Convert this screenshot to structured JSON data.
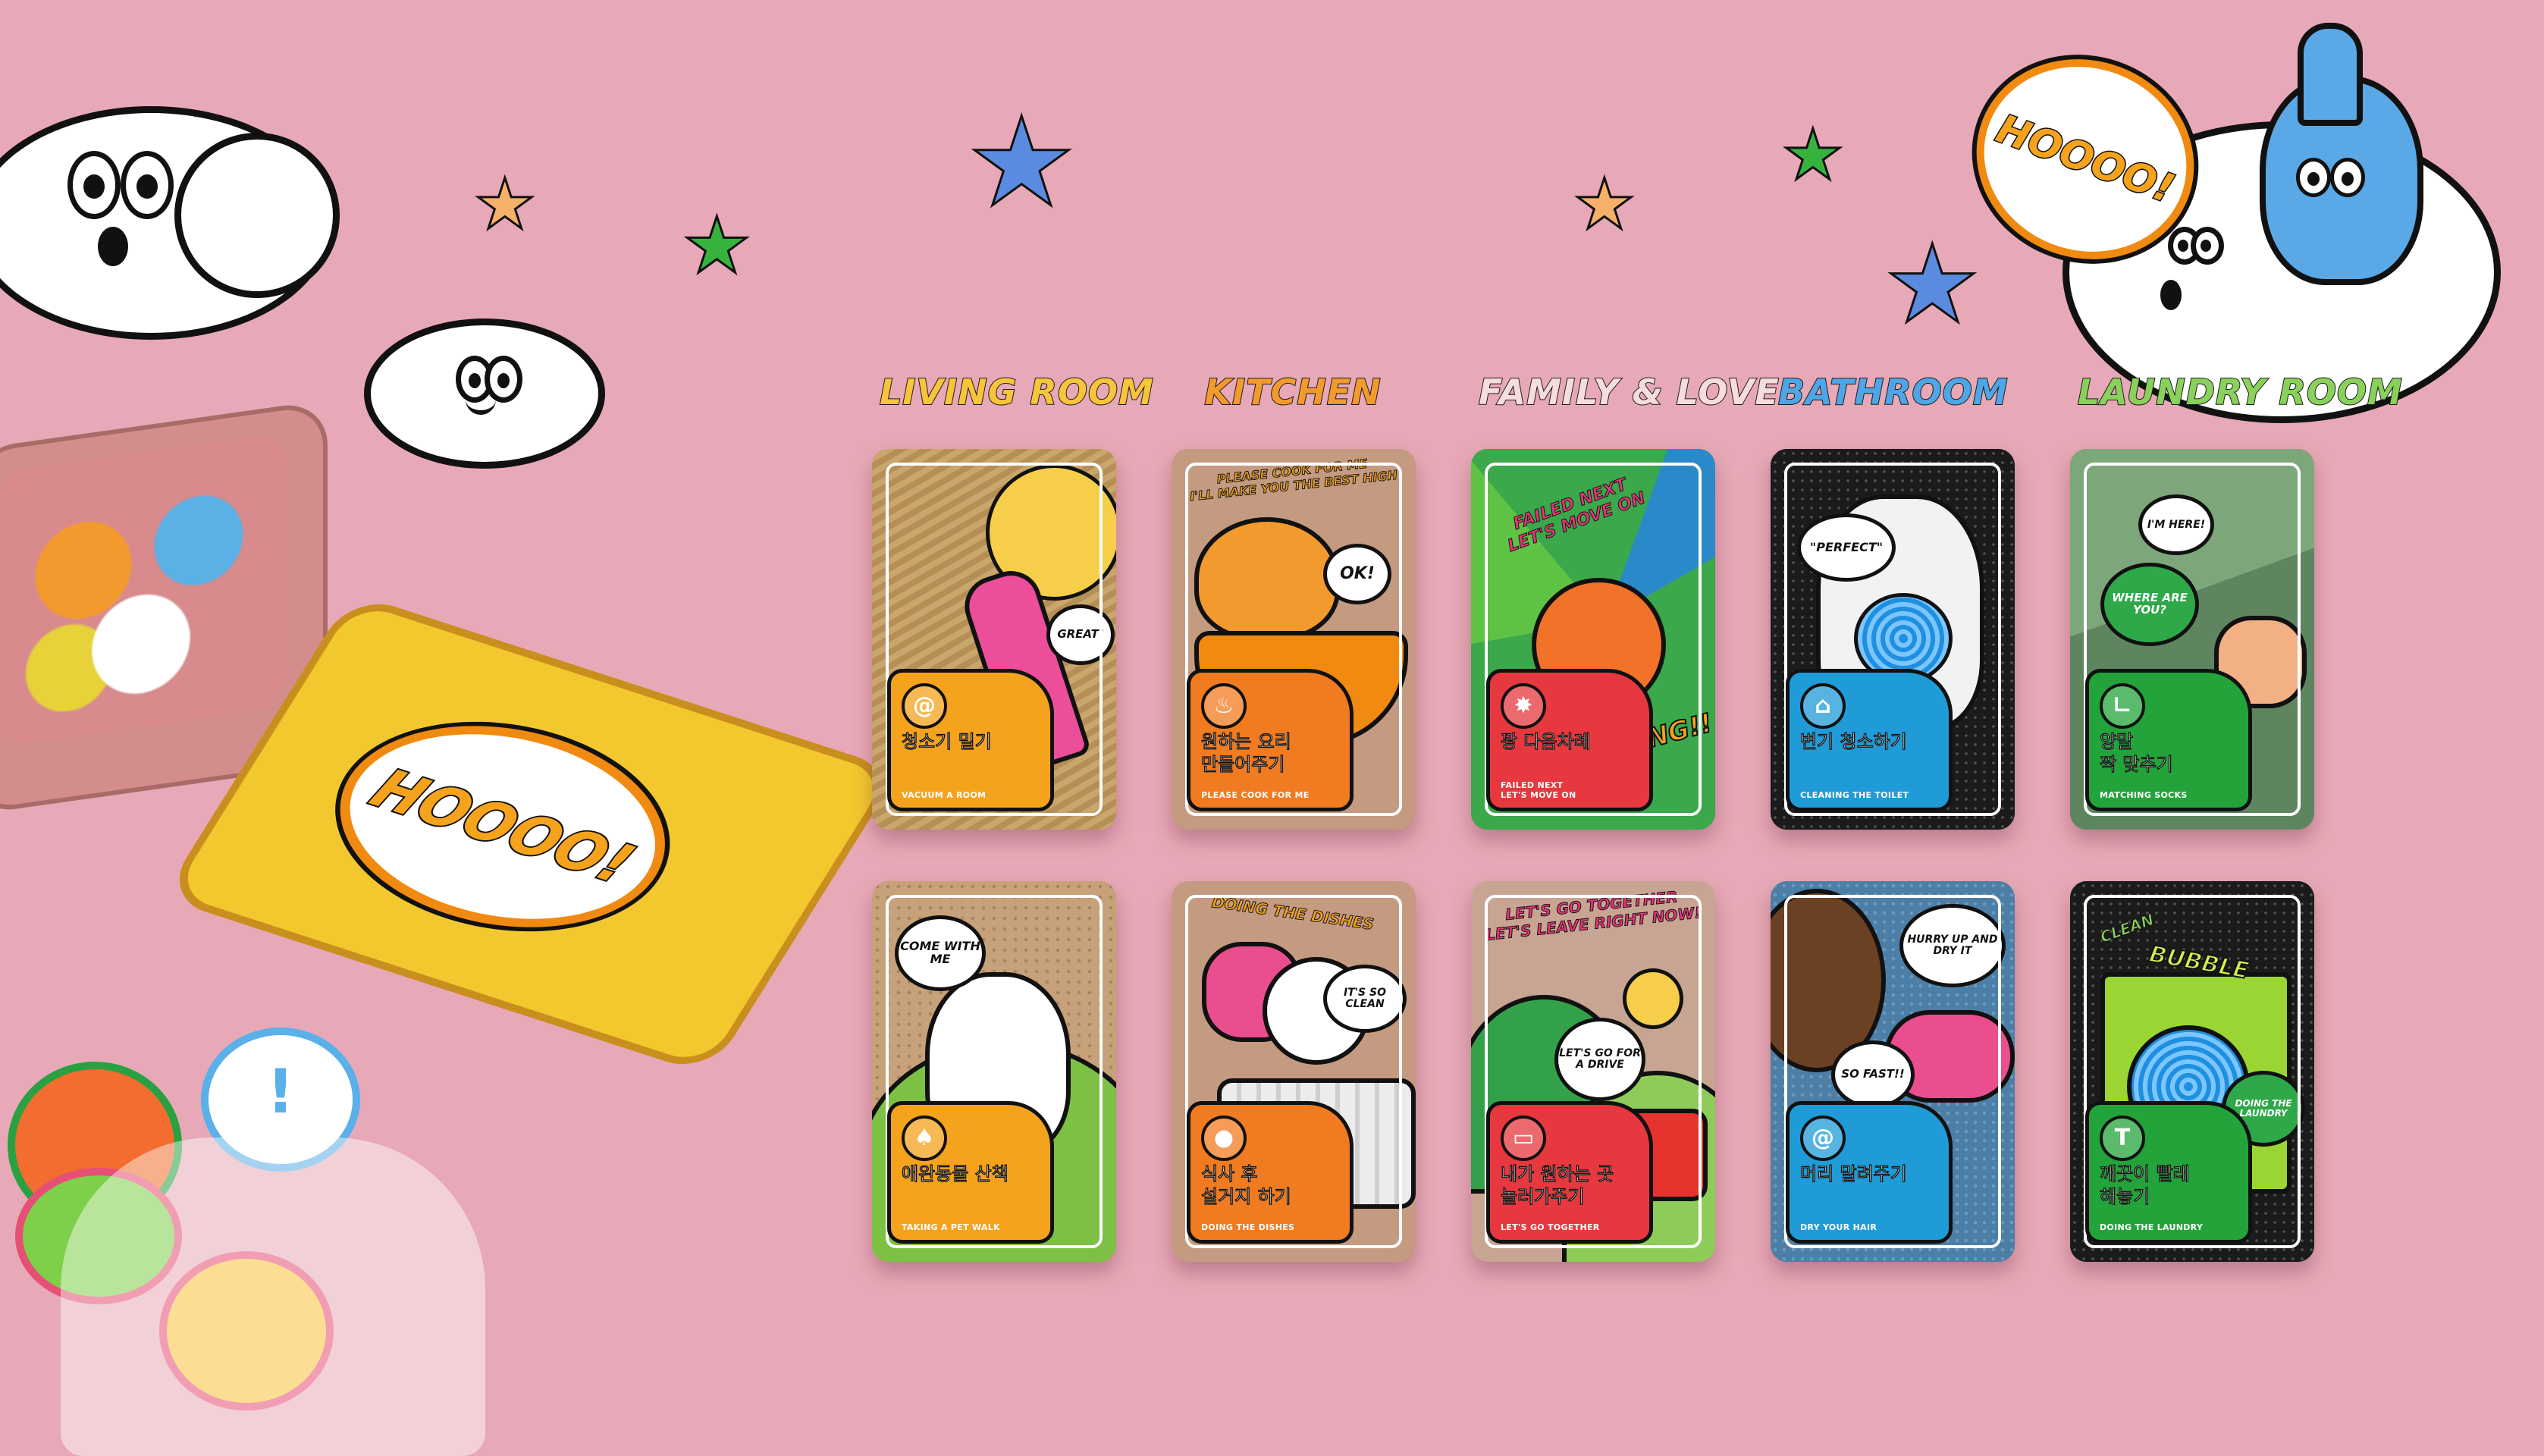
{
  "headers": {
    "living_room": "LIVING ROOM",
    "kitchen": "KITCHEN",
    "family_love": "FAMILY & LOVE",
    "bathroom": "BATHROOM",
    "laundry_room": "LAUNDRY ROOM"
  },
  "decor": {
    "hoooo_top": "HOOOO!",
    "hoooo_tin": "HOOOO!",
    "tin_small": "HOOOO!"
  },
  "cards": {
    "vacuum": {
      "ko": "청소기 밀기",
      "en": "VACUUM A ROOM",
      "bubble": "GREAT!",
      "icon": "@"
    },
    "cook": {
      "ko": "원하는 요리\n만들어주기",
      "en": "PLEASE COOK FOR ME",
      "banner": "PLEASE COOK FOR ME\nI'LL MAKE YOU THE BEST HIGH",
      "bubble": "OK!",
      "icon": "♨"
    },
    "failed": {
      "ko": "꽝 다음차례",
      "en": "FAILED NEXT\nLET'S MOVE ON",
      "banner": "FAILED NEXT\nLET'S MOVE ON",
      "bubble": "PUNG!!",
      "icon": "✸"
    },
    "toilet": {
      "ko": "변기 청소하기",
      "en": "CLEANING THE TOILET",
      "bubble": "\"PERFECT\"",
      "icon": "⌂"
    },
    "socks": {
      "ko": "양말\n짝 맞추기",
      "en": "MATCHING SOCKS",
      "bubble1": "I'M HERE!",
      "bubble2": "WHERE ARE YOU?",
      "icon": "∟"
    },
    "pet": {
      "ko": "애완동물 산책",
      "en": "TAKING A PET WALK",
      "bubble": "COME WITH ME",
      "icon": "♠"
    },
    "dishes": {
      "ko": "식사 후\n설거지 하기",
      "en": "DOING THE DISHES",
      "banner": "DOING THE DISHES",
      "bubble": "IT'S SO CLEAN",
      "icon": "●"
    },
    "together": {
      "ko": "내가 원하는 곳\n놀러가주기",
      "en": "LET'S GO TOGETHER",
      "banner": "LET'S GO TOGETHER\nLET'S LEAVE RIGHT NOW!",
      "bubble": "LET'S GO FOR A DRIVE",
      "icon": "▭"
    },
    "hair": {
      "ko": "머리 말려주기",
      "en": "DRY YOUR HAIR",
      "bubble1": "HURRY UP AND DRY IT",
      "bubble2": "SO FAST!!",
      "icon": "@"
    },
    "laundry": {
      "ko": "깨끗이 빨래\n해놓기",
      "en": "DOING THE LAUNDRY",
      "banner1": "CLEAN",
      "banner2": "BUBBLE",
      "bubble": "DOING THE LAUNDRY",
      "icon": "T"
    }
  },
  "colors": {
    "background": "#e7a9b7",
    "living_label": "#f5a21c",
    "kitchen_label": "#f07b20",
    "family_label": "#e6383e",
    "bathroom_label": "#1f9bd7",
    "laundry_label": "#23a43b"
  }
}
